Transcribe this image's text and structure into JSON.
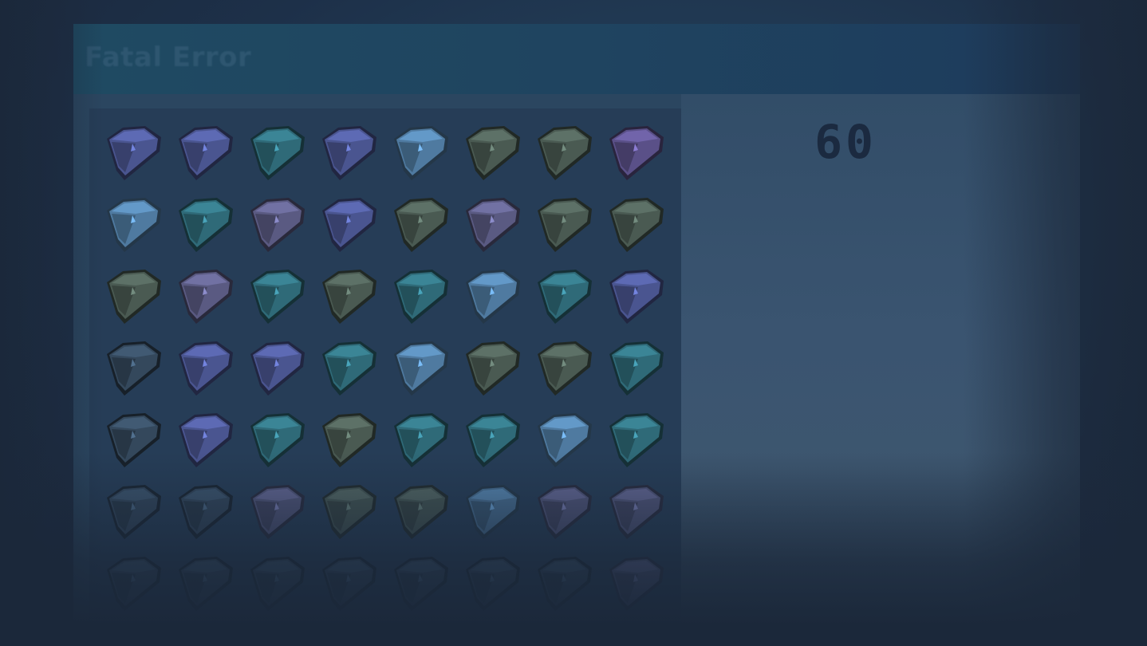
{
  "window": {
    "title": "Fatal Error"
  },
  "hud": {
    "counter": "60"
  },
  "board": {
    "rows": 7,
    "cols": 8,
    "gems": [
      [
        "indigo",
        "indigo",
        "teal",
        "indigo",
        "sky",
        "olive",
        "olive",
        "violet"
      ],
      [
        "sky",
        "teal",
        "mauve",
        "indigo",
        "olive",
        "mauve",
        "olive",
        "olive"
      ],
      [
        "olive",
        "mauve",
        "teal",
        "olive",
        "teal",
        "sky",
        "teal",
        "indigo"
      ],
      [
        "slate",
        "indigo",
        "indigo",
        "teal",
        "sky",
        "olive",
        "olive",
        "teal"
      ],
      [
        "slate",
        "indigo",
        "teal",
        "olive",
        "teal",
        "teal",
        "sky",
        "teal"
      ],
      [
        "slate",
        "slate",
        "mauve",
        "olive",
        "olive",
        "sky",
        "mauve",
        "mauve"
      ],
      [
        "slate",
        "slate",
        "slate",
        "slate",
        "slate",
        "slate",
        "slate",
        "mauve"
      ]
    ],
    "gem_colors": {
      "indigo": "#4a5590",
      "sky": "#4f7aa0",
      "teal": "#2f6a78",
      "olive": "#4a5a52",
      "mauve": "#5a5a82",
      "violet": "#5a5088",
      "slate": "#34485c"
    },
    "gem_icon": "diamond-gem-icon"
  }
}
